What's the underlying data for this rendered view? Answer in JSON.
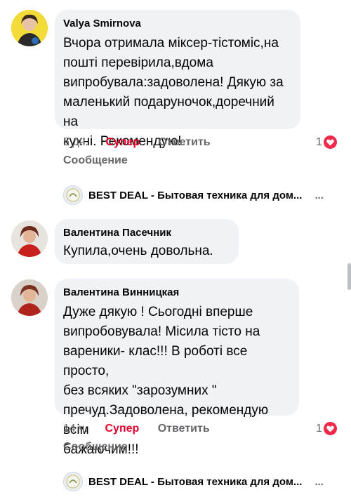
{
  "comments": [
    {
      "author": "Valya Smirnova",
      "text": "Вчора отримала міксер-тістоміс,на\nпошті перевірила,вдома\nвипробувала:задоволена! Дякую за\nмаленький подаруночок,доречний на\nкухні. Рекомендую!",
      "time": "5 дн.",
      "like": "Супер",
      "reply": "Ответить",
      "message": "Сообщение",
      "reaction_count": "1"
    },
    {
      "author": "Валентина Пасечник",
      "text": "Купила,очень довольна."
    },
    {
      "author": "Валентина Винницкая",
      "text": "Дуже дякую ! Сьогодні вперше\nвипробовувала! Місила тісто на\nвареники- клас!!! В роботі все просто,\nбез всяких \"зарозумних \"\nпречуд.Задоволена, рекомендую всім\nбажаючим!!!",
      "time": "14 ч.",
      "like": "Супер",
      "reply": "Ответить",
      "message": "Сообщение",
      "reaction_count": "1"
    }
  ],
  "page_replies": [
    {
      "name": "BEST DEAL - Бытовая техника для дом...",
      "dots": "..."
    },
    {
      "name": "BEST DEAL - Бытовая техника для дом...",
      "dots": "..."
    }
  ],
  "colors": {
    "accent": "#e4002b",
    "bubble": "#f0f2f5",
    "heart": "#f02849"
  }
}
